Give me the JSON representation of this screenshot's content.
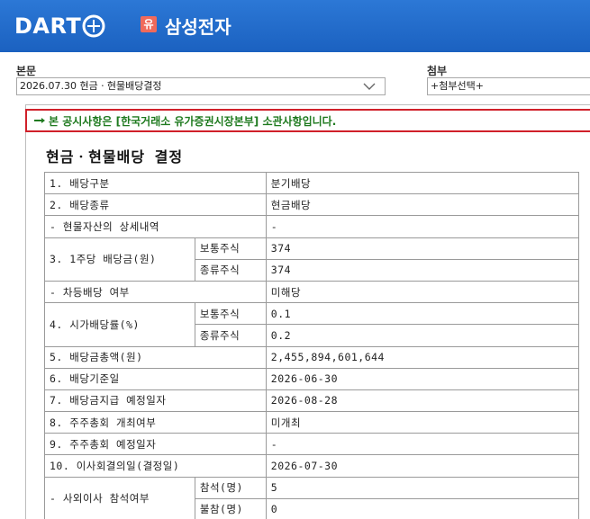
{
  "header": {
    "logo_text": "DART",
    "market_badge": "유",
    "company_name": "삼성전자",
    "accent_color": "#1b61c0"
  },
  "report_select": {
    "label": "본문",
    "value": "2026.07.30  현금ㆍ현물배당결정"
  },
  "attachment_select": {
    "label": "첨부",
    "value": "+첨부선택+"
  },
  "notice": {
    "icon": "pointing-hand-icon",
    "text": "본 공시사항은 [한국거래소 유가증권시장본부] 소관사항입니다."
  },
  "document": {
    "title": "현금ㆍ현물배당 결정",
    "rows": {
      "r1": {
        "label": "1. 배당구분",
        "value": "분기배당"
      },
      "r2": {
        "label": "2. 배당종류",
        "value": "현금배당"
      },
      "r3": {
        "label": "- 현물자산의 상세내역",
        "value": "-"
      },
      "r4": {
        "label": "3. 1주당 배당금(원)",
        "sub1": "보통주식",
        "val1": "374",
        "sub2": "종류주식",
        "val2": "374"
      },
      "r5": {
        "label": "- 차등배당 여부",
        "value": "미해당"
      },
      "r6": {
        "label": "4. 시가배당률(%)",
        "sub1": "보통주식",
        "val1": "0.1",
        "sub2": "종류주식",
        "val2": "0.2"
      },
      "r7": {
        "label": "5. 배당금총액(원)",
        "value": "2,455,894,601,644"
      },
      "r8": {
        "label": "6. 배당기준일",
        "value": "2026-06-30"
      },
      "r9": {
        "label": "7. 배당금지급 예정일자",
        "value": "2026-08-28"
      },
      "r10": {
        "label": "8. 주주총회 개최여부",
        "value": "미개최"
      },
      "r11": {
        "label": "9. 주주총회 예정일자",
        "value": "-"
      },
      "r12": {
        "label": "10. 이사회결의일(결정일)",
        "value": "2026-07-30"
      },
      "r13": {
        "label": "- 사외이사 참석여부",
        "sub1": "참석(명)",
        "val1": "5",
        "sub2": "불참(명)",
        "val2": "0"
      }
    }
  }
}
